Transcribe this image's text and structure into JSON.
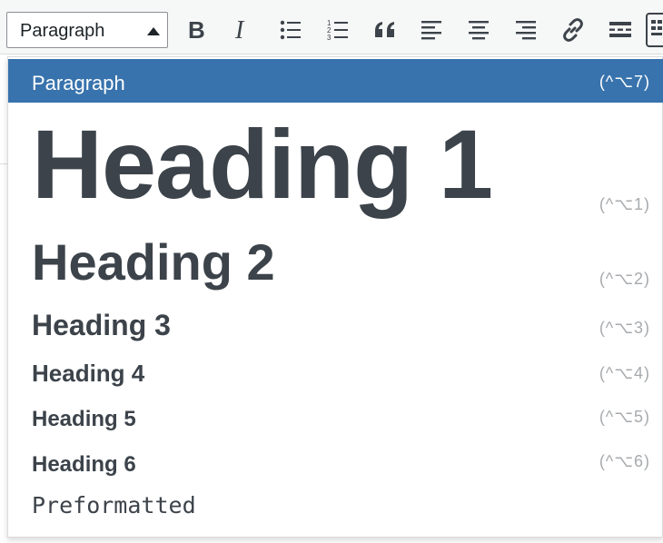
{
  "toolbar": {
    "format_select": {
      "selected": "Paragraph"
    },
    "buttons": [
      {
        "name": "bold-button",
        "icon": "bold-icon"
      },
      {
        "name": "italic-button",
        "icon": "italic-icon"
      },
      {
        "name": "bulleted-list-button",
        "icon": "bulleted-list-icon"
      },
      {
        "name": "numbered-list-button",
        "icon": "numbered-list-icon"
      },
      {
        "name": "blockquote-button",
        "icon": "blockquote-icon"
      },
      {
        "name": "align-left-button",
        "icon": "align-left-icon"
      },
      {
        "name": "align-center-button",
        "icon": "align-center-icon"
      },
      {
        "name": "align-right-button",
        "icon": "align-right-icon"
      },
      {
        "name": "link-button",
        "icon": "link-icon"
      },
      {
        "name": "read-more-button",
        "icon": "read-more-icon"
      },
      {
        "name": "toolbar-toggle-button",
        "icon": "toolbar-toggle-icon"
      }
    ],
    "icon_color": "#3c434a"
  },
  "dropdown": {
    "selected_bg": "#3873ad",
    "items": [
      {
        "label": "Paragraph",
        "shortcut": "(^⌥7)",
        "selected": true
      },
      {
        "label": "Heading 1",
        "shortcut": "(^⌥1)"
      },
      {
        "label": "Heading 2",
        "shortcut": "(^⌥2)"
      },
      {
        "label": "Heading 3",
        "shortcut": "(^⌥3)"
      },
      {
        "label": "Heading 4",
        "shortcut": "(^⌥4)"
      },
      {
        "label": "Heading 5",
        "shortcut": "(^⌥5)"
      },
      {
        "label": "Heading 6",
        "shortcut": "(^⌥6)"
      },
      {
        "label": "Preformatted",
        "shortcut": ""
      }
    ]
  }
}
